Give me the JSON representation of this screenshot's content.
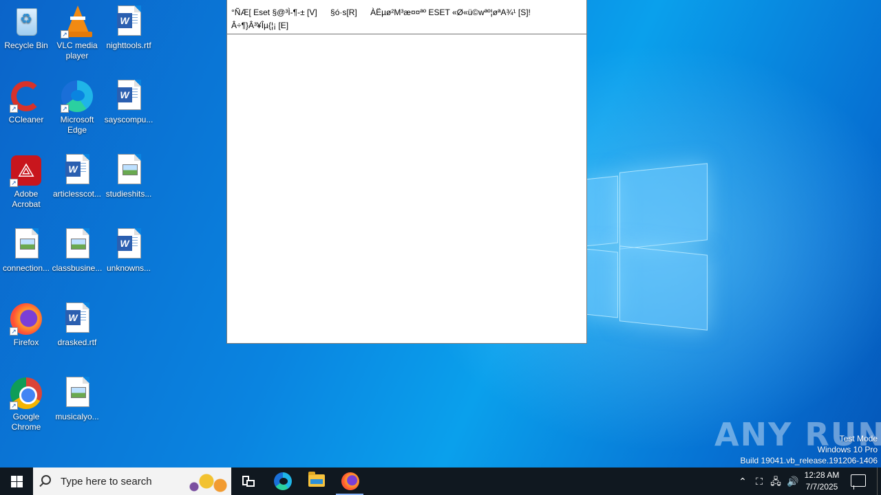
{
  "desktop": {
    "icons": [
      {
        "label": "Recycle Bin",
        "icon": "recycle-bin-icon"
      },
      {
        "label": "VLC media player",
        "icon": "vlc-icon"
      },
      {
        "label": "nighttools.rtf",
        "icon": "word-document-icon"
      },
      {
        "label": "CCleaner",
        "icon": "ccleaner-icon"
      },
      {
        "label": "Microsoft Edge",
        "icon": "edge-icon"
      },
      {
        "label": "sayscompu...",
        "icon": "word-document-icon"
      },
      {
        "label": "Adobe Acrobat",
        "icon": "acrobat-icon"
      },
      {
        "label": "articlesscot...",
        "icon": "word-document-icon"
      },
      {
        "label": "studieshits...",
        "icon": "image-file-icon"
      },
      {
        "label": "connection...",
        "icon": "image-file-icon"
      },
      {
        "label": "classbusine...",
        "icon": "image-file-icon"
      },
      {
        "label": "unknowns...",
        "icon": "word-document-icon"
      },
      {
        "label": "Firefox",
        "icon": "firefox-icon"
      },
      {
        "label": "drasked.rtf",
        "icon": "word-document-icon"
      },
      {
        "label": "Google Chrome",
        "icon": "chrome-icon"
      },
      {
        "label": "musicalyo...",
        "icon": "image-file-icon"
      }
    ]
  },
  "window": {
    "menu": [
      "°ÑÆ[ Eset §@³Ì-¶-± [V]",
      "§ó·s[R]",
      "ÀËµø²M³æ¤¤ªº ESET «Ø«ü©wªº¦øªA¾¹ [S]!",
      "Â÷¶}Â³¥Îµ{¦¡ [E]"
    ]
  },
  "watermark": {
    "brand": "ANY RUN",
    "test_mode": "Test Mode",
    "edition": "Windows 10 Pro",
    "build": "Build 19041.vb_release.191206-1406"
  },
  "taskbar": {
    "search_placeholder": "Type here to search",
    "time": "12:28 AM",
    "date": "7/7/2025",
    "pinned": [
      "task-view-icon",
      "edge-icon",
      "file-explorer-icon",
      "firefox-icon"
    ]
  },
  "colors": {
    "taskbar": "#101820",
    "wallpaper": "#0a84e0"
  }
}
